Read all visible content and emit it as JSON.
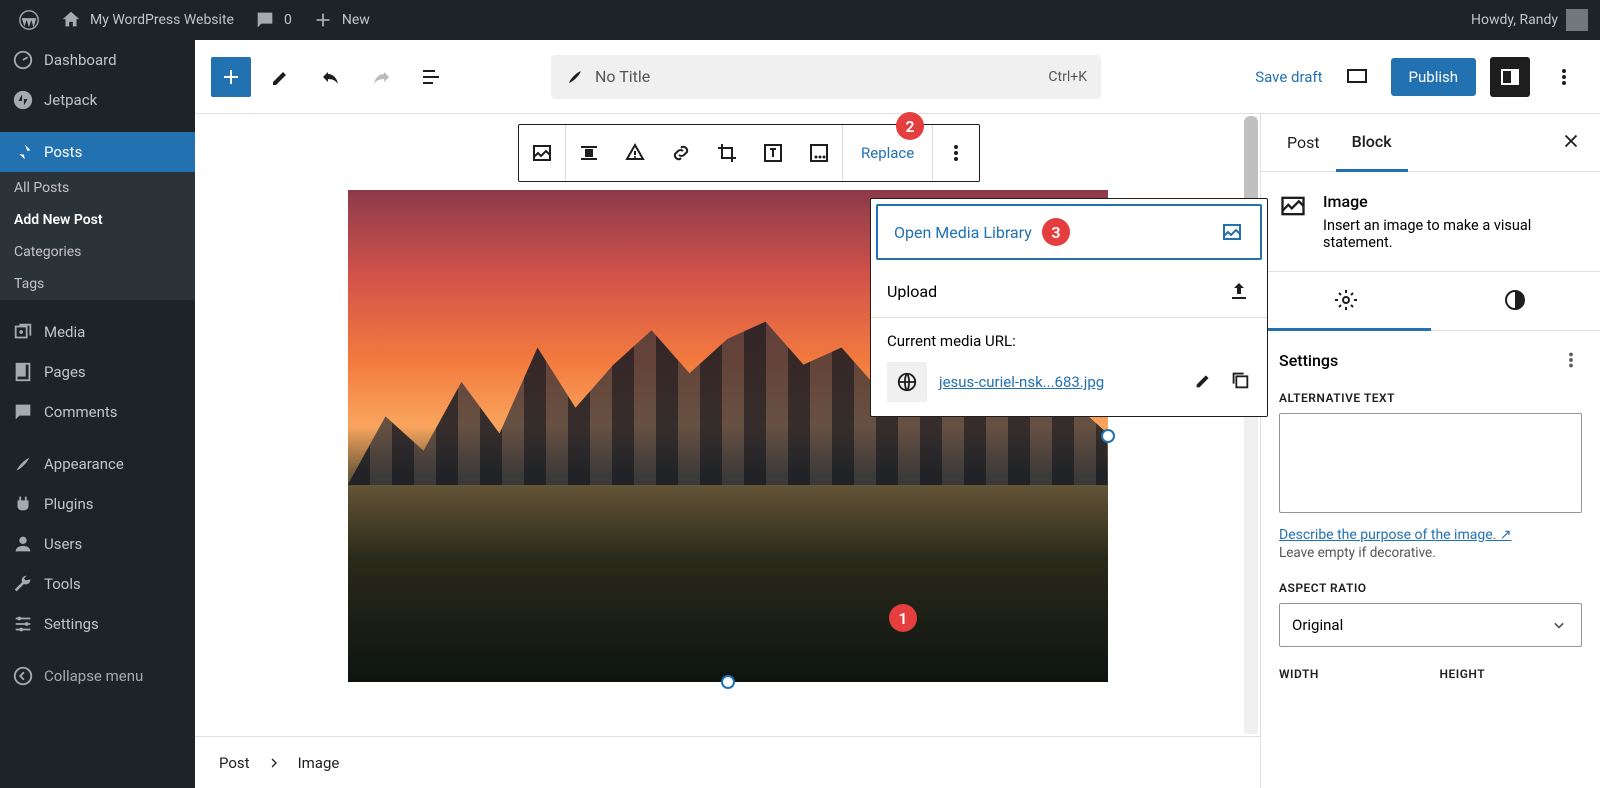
{
  "adminBar": {
    "siteTitle": "My WordPress Website",
    "commentsCount": "0",
    "newLabel": "New",
    "greeting": "Howdy, Randy"
  },
  "sidebar": {
    "dashboard": "Dashboard",
    "jetpack": "Jetpack",
    "posts": "Posts",
    "postsSubmenu": {
      "all": "All Posts",
      "addNew": "Add New Post",
      "categories": "Categories",
      "tags": "Tags"
    },
    "media": "Media",
    "pages": "Pages",
    "comments": "Comments",
    "appearance": "Appearance",
    "plugins": "Plugins",
    "users": "Users",
    "tools": "Tools",
    "settings": "Settings",
    "collapse": "Collapse menu"
  },
  "editorHeader": {
    "titlePlaceholder": "No Title",
    "shortcut": "Ctrl+K",
    "saveDraft": "Save draft",
    "publish": "Publish"
  },
  "blockToolbar": {
    "replace": "Replace"
  },
  "replacePopover": {
    "openMedia": "Open Media Library",
    "upload": "Upload",
    "currentUrlLabel": "Current media URL:",
    "filename": "jesus-curiel-nsk...683.jpg"
  },
  "annotations": {
    "one": "1",
    "two": "2",
    "three": "3"
  },
  "inspector": {
    "tabPost": "Post",
    "tabBlock": "Block",
    "blockTitle": "Image",
    "blockDesc": "Insert an image to make a visual statement.",
    "settings": "Settings",
    "altTextLabel": "ALTERNATIVE TEXT",
    "describeLink": "Describe the purpose of the image. ↗",
    "leaveEmpty": "Leave empty if decorative.",
    "aspectLabel": "ASPECT RATIO",
    "aspectValue": "Original",
    "widthLabel": "WIDTH",
    "heightLabel": "HEIGHT"
  },
  "breadcrumb": {
    "post": "Post",
    "image": "Image"
  }
}
